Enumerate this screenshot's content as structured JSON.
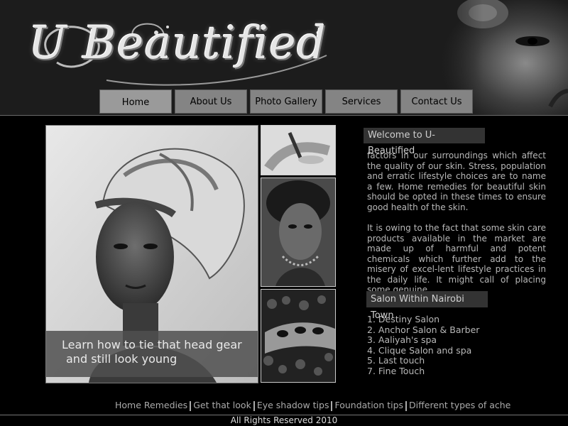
{
  "site": {
    "logo_text": "U Beautified"
  },
  "nav": {
    "items": [
      "Home",
      "About Us",
      "Photo Gallery",
      "Services",
      "Contact Us"
    ]
  },
  "feature": {
    "caption_line1": "Learn how to tie that head gear",
    "caption_line2": "and still look young"
  },
  "welcome": {
    "heading": "Welcome to U-Beautified",
    "para1": "factors in our surroundings which affect the quality of our skin. Stress, population and erratic lifestyle choices are to name a few. Home remedies for beautiful skin should be opted in these times to ensure good health of the skin.",
    "para2": "It is owing to the fact that some skin care products available in the market are made up of harmful and potent chemicals which further add to the misery of excel-lent lifestyle practices in the daily life. It might call of placing some genuine"
  },
  "salons": {
    "heading": "Salon Within Nairobi Town",
    "items": [
      "1. Destiny Salon",
      "2. Anchor Salon & Barber",
      "3. Aaliyah's spa",
      "4. Clique Salon and spa",
      "5. Last touch",
      "7. Fine Touch"
    ]
  },
  "footer": {
    "links": [
      "Home Remedies",
      "Get that look",
      "Eye shadow tips",
      "Foundation tips",
      "Different types of ache"
    ],
    "copyright": "All Rights Reserved 2010"
  }
}
